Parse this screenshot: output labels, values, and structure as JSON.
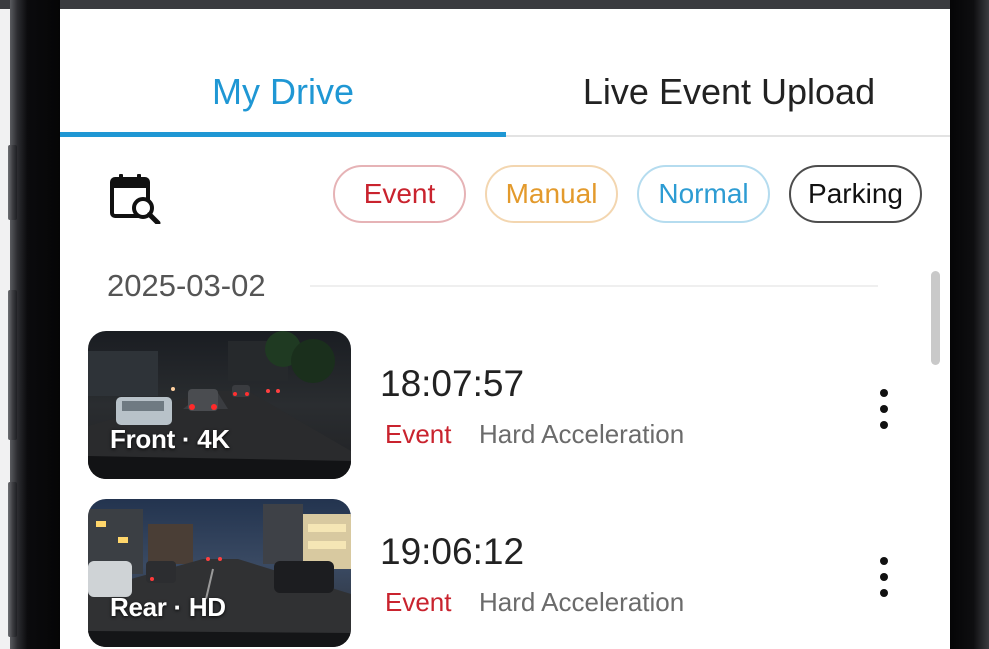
{
  "tabs": [
    {
      "label": "My Drive",
      "active": true
    },
    {
      "label": "Live Event Upload",
      "active": false
    }
  ],
  "filters": {
    "calendar_icon": "calendar-search-icon",
    "chips": [
      {
        "label": "Event",
        "color": "#c9232e"
      },
      {
        "label": "Manual",
        "color": "#e39a2c"
      },
      {
        "label": "Normal",
        "color": "#2d9cd3"
      },
      {
        "label": "Parking",
        "color": "#111111"
      }
    ]
  },
  "list": {
    "date": "2025-03-02",
    "items": [
      {
        "thumb_label": "Front · 4K",
        "time": "18:07:57",
        "type": "Event",
        "description": "Hard Acceleration",
        "more_icon": "more-vertical-icon"
      },
      {
        "thumb_label": "Rear · HD",
        "time": "19:06:12",
        "type": "Event",
        "description": "Hard Acceleration",
        "more_icon": "more-vertical-icon"
      }
    ]
  },
  "colors": {
    "accent": "#1f97d4",
    "event": "#c9232e"
  }
}
